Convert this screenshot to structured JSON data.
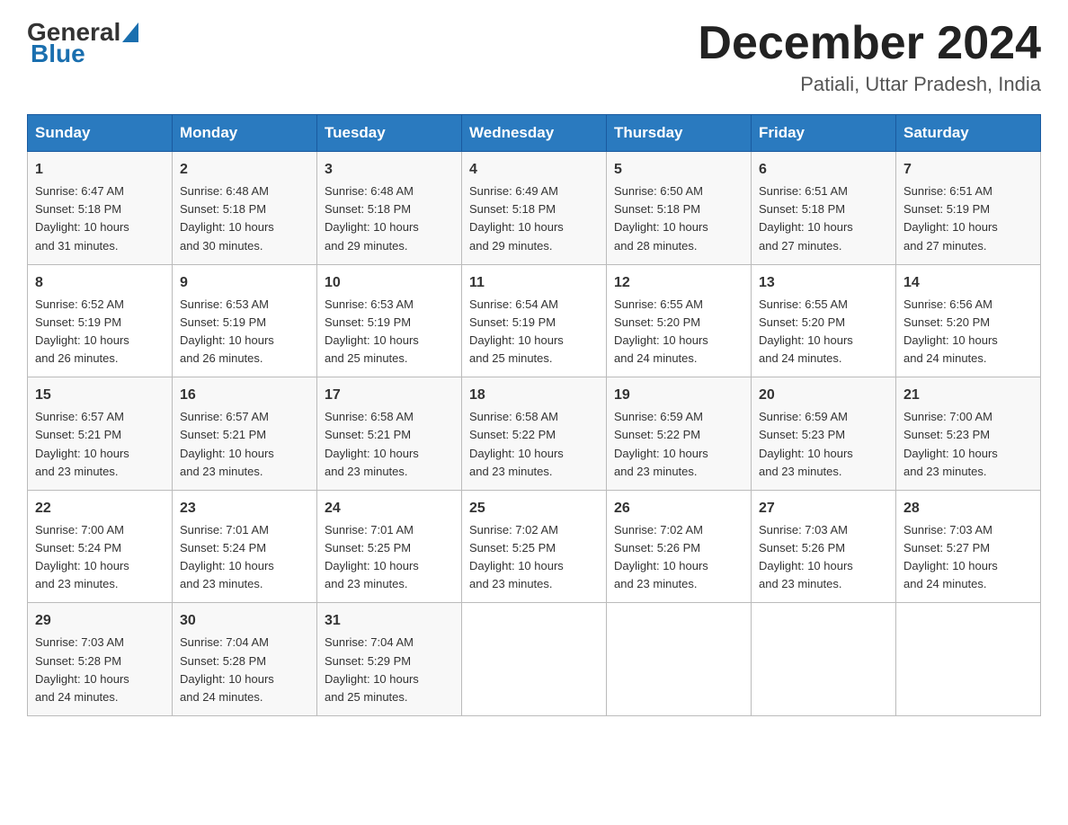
{
  "logo": {
    "general": "General",
    "blue": "Blue"
  },
  "title": "December 2024",
  "subtitle": "Patiali, Uttar Pradesh, India",
  "weekdays": [
    "Sunday",
    "Monday",
    "Tuesday",
    "Wednesday",
    "Thursday",
    "Friday",
    "Saturday"
  ],
  "weeks": [
    [
      {
        "day": "1",
        "sunrise": "6:47 AM",
        "sunset": "5:18 PM",
        "daylight": "10 hours and 31 minutes."
      },
      {
        "day": "2",
        "sunrise": "6:48 AM",
        "sunset": "5:18 PM",
        "daylight": "10 hours and 30 minutes."
      },
      {
        "day": "3",
        "sunrise": "6:48 AM",
        "sunset": "5:18 PM",
        "daylight": "10 hours and 29 minutes."
      },
      {
        "day": "4",
        "sunrise": "6:49 AM",
        "sunset": "5:18 PM",
        "daylight": "10 hours and 29 minutes."
      },
      {
        "day": "5",
        "sunrise": "6:50 AM",
        "sunset": "5:18 PM",
        "daylight": "10 hours and 28 minutes."
      },
      {
        "day": "6",
        "sunrise": "6:51 AM",
        "sunset": "5:18 PM",
        "daylight": "10 hours and 27 minutes."
      },
      {
        "day": "7",
        "sunrise": "6:51 AM",
        "sunset": "5:19 PM",
        "daylight": "10 hours and 27 minutes."
      }
    ],
    [
      {
        "day": "8",
        "sunrise": "6:52 AM",
        "sunset": "5:19 PM",
        "daylight": "10 hours and 26 minutes."
      },
      {
        "day": "9",
        "sunrise": "6:53 AM",
        "sunset": "5:19 PM",
        "daylight": "10 hours and 26 minutes."
      },
      {
        "day": "10",
        "sunrise": "6:53 AM",
        "sunset": "5:19 PM",
        "daylight": "10 hours and 25 minutes."
      },
      {
        "day": "11",
        "sunrise": "6:54 AM",
        "sunset": "5:19 PM",
        "daylight": "10 hours and 25 minutes."
      },
      {
        "day": "12",
        "sunrise": "6:55 AM",
        "sunset": "5:20 PM",
        "daylight": "10 hours and 24 minutes."
      },
      {
        "day": "13",
        "sunrise": "6:55 AM",
        "sunset": "5:20 PM",
        "daylight": "10 hours and 24 minutes."
      },
      {
        "day": "14",
        "sunrise": "6:56 AM",
        "sunset": "5:20 PM",
        "daylight": "10 hours and 24 minutes."
      }
    ],
    [
      {
        "day": "15",
        "sunrise": "6:57 AM",
        "sunset": "5:21 PM",
        "daylight": "10 hours and 23 minutes."
      },
      {
        "day": "16",
        "sunrise": "6:57 AM",
        "sunset": "5:21 PM",
        "daylight": "10 hours and 23 minutes."
      },
      {
        "day": "17",
        "sunrise": "6:58 AM",
        "sunset": "5:21 PM",
        "daylight": "10 hours and 23 minutes."
      },
      {
        "day": "18",
        "sunrise": "6:58 AM",
        "sunset": "5:22 PM",
        "daylight": "10 hours and 23 minutes."
      },
      {
        "day": "19",
        "sunrise": "6:59 AM",
        "sunset": "5:22 PM",
        "daylight": "10 hours and 23 minutes."
      },
      {
        "day": "20",
        "sunrise": "6:59 AM",
        "sunset": "5:23 PM",
        "daylight": "10 hours and 23 minutes."
      },
      {
        "day": "21",
        "sunrise": "7:00 AM",
        "sunset": "5:23 PM",
        "daylight": "10 hours and 23 minutes."
      }
    ],
    [
      {
        "day": "22",
        "sunrise": "7:00 AM",
        "sunset": "5:24 PM",
        "daylight": "10 hours and 23 minutes."
      },
      {
        "day": "23",
        "sunrise": "7:01 AM",
        "sunset": "5:24 PM",
        "daylight": "10 hours and 23 minutes."
      },
      {
        "day": "24",
        "sunrise": "7:01 AM",
        "sunset": "5:25 PM",
        "daylight": "10 hours and 23 minutes."
      },
      {
        "day": "25",
        "sunrise": "7:02 AM",
        "sunset": "5:25 PM",
        "daylight": "10 hours and 23 minutes."
      },
      {
        "day": "26",
        "sunrise": "7:02 AM",
        "sunset": "5:26 PM",
        "daylight": "10 hours and 23 minutes."
      },
      {
        "day": "27",
        "sunrise": "7:03 AM",
        "sunset": "5:26 PM",
        "daylight": "10 hours and 23 minutes."
      },
      {
        "day": "28",
        "sunrise": "7:03 AM",
        "sunset": "5:27 PM",
        "daylight": "10 hours and 24 minutes."
      }
    ],
    [
      {
        "day": "29",
        "sunrise": "7:03 AM",
        "sunset": "5:28 PM",
        "daylight": "10 hours and 24 minutes."
      },
      {
        "day": "30",
        "sunrise": "7:04 AM",
        "sunset": "5:28 PM",
        "daylight": "10 hours and 24 minutes."
      },
      {
        "day": "31",
        "sunrise": "7:04 AM",
        "sunset": "5:29 PM",
        "daylight": "10 hours and 25 minutes."
      },
      null,
      null,
      null,
      null
    ]
  ],
  "labels": {
    "sunrise": "Sunrise:",
    "sunset": "Sunset:",
    "daylight": "Daylight:"
  }
}
